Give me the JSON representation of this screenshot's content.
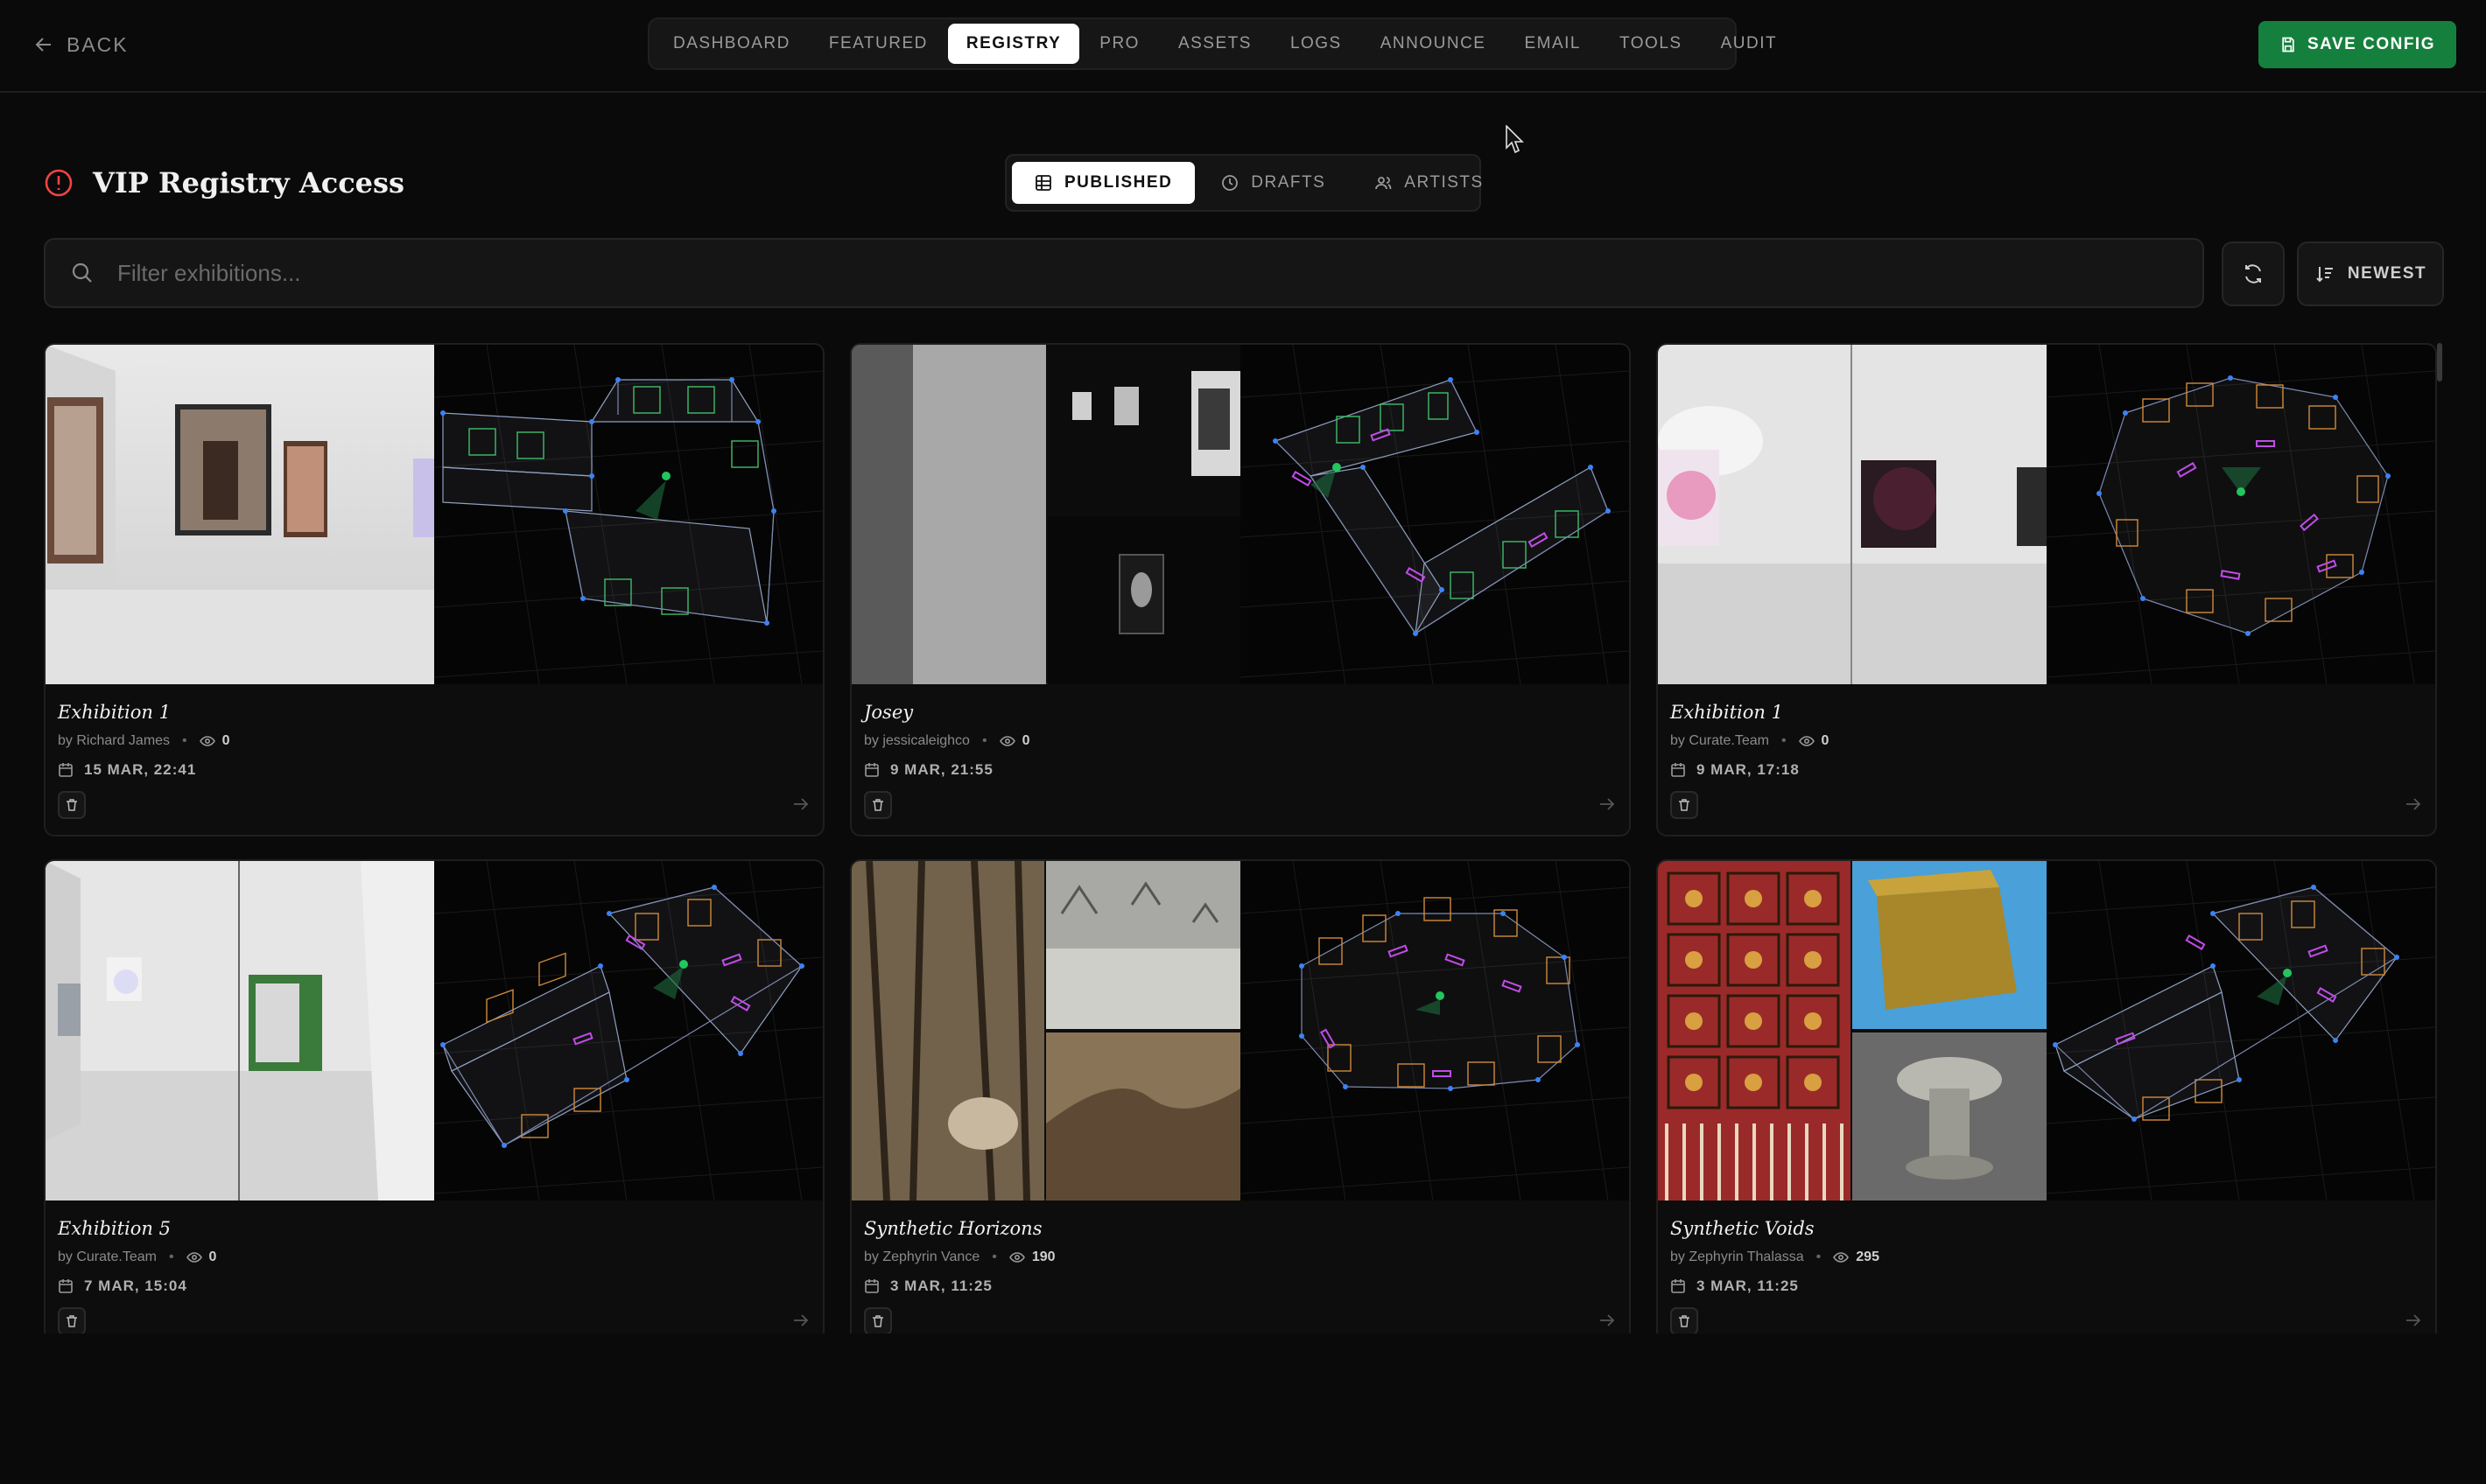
{
  "header": {
    "back_label": "BACK",
    "nav_tabs": [
      {
        "label": "DASHBOARD"
      },
      {
        "label": "FEATURED"
      },
      {
        "label": "REGISTRY"
      },
      {
        "label": "PRO"
      },
      {
        "label": "ASSETS"
      },
      {
        "label": "LOGS"
      },
      {
        "label": "ANNOUNCE"
      },
      {
        "label": "EMAIL"
      },
      {
        "label": "TOOLS"
      },
      {
        "label": "AUDIT"
      }
    ],
    "active_tab": "REGISTRY",
    "save_label": "SAVE CONFIG"
  },
  "page": {
    "title": "VIP Registry Access",
    "view_tabs": [
      {
        "label": "PUBLISHED",
        "icon": "grid-icon"
      },
      {
        "label": "DRAFTS",
        "icon": "clock-icon"
      },
      {
        "label": "ARTISTS",
        "icon": "users-icon"
      }
    ],
    "active_view": "PUBLISHED"
  },
  "toolbar": {
    "search_placeholder": "Filter exhibitions...",
    "sort_label": "NEWEST"
  },
  "exhibitions": [
    {
      "title": "Exhibition 1",
      "author": "by Richard James",
      "views": "0",
      "date": "15 MAR, 22:41"
    },
    {
      "title": "Josey",
      "author": "by jessicaleighco",
      "views": "0",
      "date": "9 MAR, 21:55"
    },
    {
      "title": "Exhibition 1",
      "author": "by Curate.Team",
      "views": "0",
      "date": "9 MAR, 17:18"
    },
    {
      "title": "Exhibition 5",
      "author": "by Curate.Team",
      "views": "0",
      "date": "7 MAR, 15:04"
    },
    {
      "title": "Synthetic Horizons",
      "author": "by Zephyrin Vance",
      "views": "190",
      "date": "3 MAR, 11:25"
    },
    {
      "title": "Synthetic Voids",
      "author": "by Zephyrin Thalassa",
      "views": "295",
      "date": "3 MAR, 11:25"
    }
  ],
  "colors": {
    "accent_green": "#15803d",
    "alert_red": "#ef4444",
    "wall_orange": "#d08a3a",
    "wall_green": "#3fbf6a",
    "node_blue": "#3b82f6",
    "marker_purple": "#c04ce8"
  }
}
